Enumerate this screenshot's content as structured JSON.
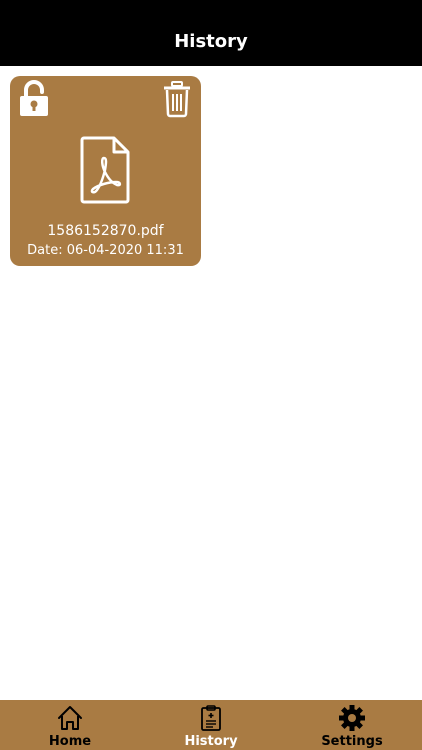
{
  "header": {
    "title": "History"
  },
  "history": {
    "items": [
      {
        "file_name": "1586152870.pdf",
        "date": "Date: 06-04-2020 11:31",
        "icons": {
          "lock": "lock-icon",
          "delete": "trash-icon",
          "file": "pdf-file-icon"
        }
      }
    ]
  },
  "tabbar": {
    "tabs": [
      {
        "label": "Home",
        "icon": "home-icon",
        "active": false
      },
      {
        "label": "History",
        "icon": "history-clipboard-icon",
        "active": true
      },
      {
        "label": "Settings",
        "icon": "gear-icon",
        "active": false
      }
    ]
  },
  "colors": {
    "header_bg": "#000000",
    "accent_brown": "#a97b43",
    "background": "#ffffff",
    "active_tab_text": "#ffffff",
    "inactive_tab_text": "#000000"
  }
}
